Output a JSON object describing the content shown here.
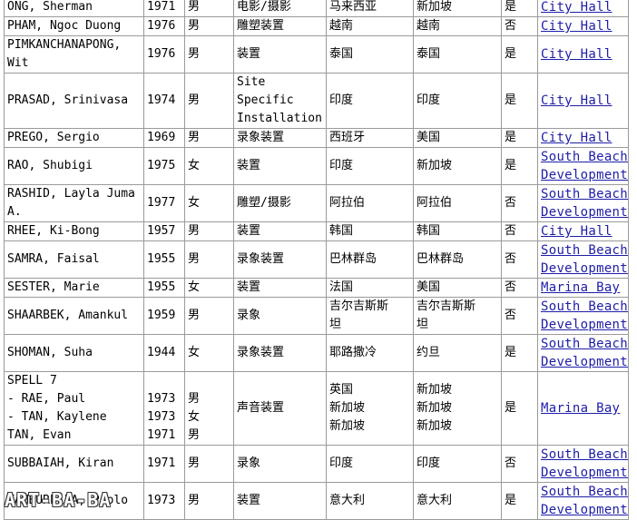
{
  "table": {
    "rows": [
      {
        "name": [
          "ONG, Sherman"
        ],
        "year": [
          "1971"
        ],
        "gender": [
          "男"
        ],
        "medium": "电影/摄影",
        "nationality": [
          "马来西亚"
        ],
        "residence": [
          "新加坡"
        ],
        "flag": "是",
        "site": [
          "City Hall"
        ]
      },
      {
        "name": [
          "PHAM, Ngoc Duong"
        ],
        "year": [
          "1976"
        ],
        "gender": [
          "男"
        ],
        "medium": "雕塑装置",
        "nationality": [
          "越南"
        ],
        "residence": [
          "越南"
        ],
        "flag": "否",
        "site": [
          "City Hall"
        ]
      },
      {
        "name": [
          "PIMKANCHANAPONG,",
          "Wit"
        ],
        "year": [
          "1976"
        ],
        "gender": [
          "男"
        ],
        "medium": "装置",
        "nationality": [
          "泰国"
        ],
        "residence": [
          "泰国"
        ],
        "flag": "是",
        "site": [
          "City Hall"
        ]
      },
      {
        "name": [
          "PRASAD, Srinivasa"
        ],
        "year": [
          "1974"
        ],
        "gender": [
          "男"
        ],
        "medium": "Site Specific Installation",
        "nationality": [
          "印度"
        ],
        "residence": [
          "印度"
        ],
        "flag": "是",
        "site": [
          "City Hall"
        ]
      },
      {
        "name": [
          "PREGO, Sergio"
        ],
        "year": [
          "1969"
        ],
        "gender": [
          "男"
        ],
        "medium": "录象装置",
        "nationality": [
          "西班牙"
        ],
        "residence": [
          "美国"
        ],
        "flag": "是",
        "site": [
          "City Hall"
        ]
      },
      {
        "name": [
          "RAO, Shubigi"
        ],
        "year": [
          "1975"
        ],
        "gender": [
          "女"
        ],
        "medium": "装置",
        "nationality": [
          "印度"
        ],
        "residence": [
          "新加坡"
        ],
        "flag": "是",
        "site": [
          "South Beach",
          "Development"
        ]
      },
      {
        "name": [
          "RASHID, Layla Juma",
          "A."
        ],
        "year": [
          "1977"
        ],
        "gender": [
          "女"
        ],
        "medium": "雕塑/摄影",
        "nationality": [
          "阿拉伯"
        ],
        "residence": [
          "阿拉伯"
        ],
        "flag": "否",
        "site": [
          "South Beach",
          "Development"
        ]
      },
      {
        "name": [
          "RHEE, Ki-Bong"
        ],
        "year": [
          "1957"
        ],
        "gender": [
          "男"
        ],
        "medium": "装置",
        "nationality": [
          "韩国"
        ],
        "residence": [
          "韩国"
        ],
        "flag": "否",
        "site": [
          "City Hall"
        ]
      },
      {
        "name": [
          "SAMRA, Faisal"
        ],
        "year": [
          "1955"
        ],
        "gender": [
          "男"
        ],
        "medium": "录象装置",
        "nationality": [
          "巴林群岛"
        ],
        "residence": [
          "巴林群岛"
        ],
        "flag": "否",
        "site": [
          "South Beach",
          "Development"
        ]
      },
      {
        "name": [
          "SESTER, Marie"
        ],
        "year": [
          "1955"
        ],
        "gender": [
          "女"
        ],
        "medium": "装置",
        "nationality": [
          "法国"
        ],
        "residence": [
          "美国"
        ],
        "flag": "否",
        "site": [
          "Marina Bay"
        ]
      },
      {
        "name": [
          "SHAARBEK, Amankul"
        ],
        "year": [
          "1959"
        ],
        "gender": [
          "男"
        ],
        "medium": "录象",
        "nationality": [
          "吉尔吉斯斯",
          "坦"
        ],
        "residence": [
          "吉尔吉斯斯",
          "坦"
        ],
        "flag": "否",
        "site": [
          "South Beach",
          "Development"
        ]
      },
      {
        "name": [
          "SHOMAN, Suha"
        ],
        "year": [
          "1944"
        ],
        "gender": [
          "女"
        ],
        "medium": "录象装置",
        "nationality": [
          "耶路撒冷"
        ],
        "residence": [
          "约旦"
        ],
        "flag": "是",
        "site": [
          "South Beach",
          "Development"
        ]
      },
      {
        "name": [
          "SPELL 7",
          "- RAE, Paul",
          "- TAN, Kaylene",
          "TAN, Evan"
        ],
        "year": [
          "",
          "1973",
          "1973",
          "1971"
        ],
        "gender": [
          "",
          "男",
          "女",
          "男"
        ],
        "medium": "声音装置",
        "nationality": [
          "英国",
          "新加坡",
          "新加坡"
        ],
        "residence": [
          "新加坡",
          "新加坡",
          "新加坡"
        ],
        "flag": "是",
        "site": [
          "Marina Bay"
        ]
      },
      {
        "name": [
          "SUBBAIAH, Kiran"
        ],
        "year": [
          "1971"
        ],
        "gender": [
          "男"
        ],
        "medium": "录象",
        "nationality": [
          "印度"
        ],
        "residence": [
          "印度"
        ],
        "flag": "否",
        "site": [
          "South Beach",
          "Development"
        ]
      },
      {
        "name": [
          "TAMBURELLA, Paolo"
        ],
        "year": [
          "1973"
        ],
        "gender": [
          "男"
        ],
        "medium": "装置",
        "nationality": [
          "意大利"
        ],
        "residence": [
          "意大利"
        ],
        "flag": "是",
        "site": [
          "South Beach",
          "Development"
        ]
      }
    ]
  },
  "watermark": "ART-BA-BA",
  "colors": {
    "link": "#1d1da8",
    "border": "#9a9a9a"
  }
}
